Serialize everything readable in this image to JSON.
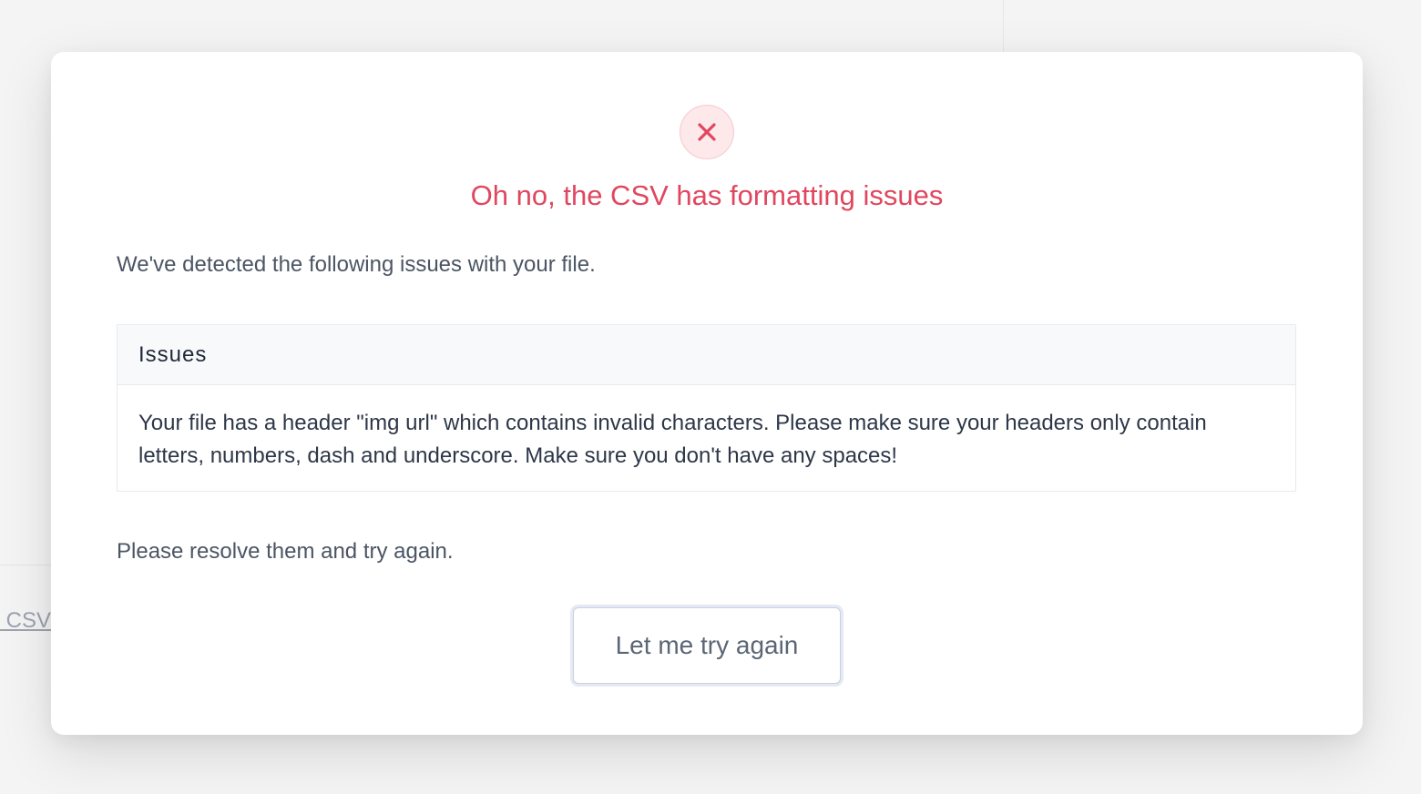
{
  "background": {
    "link_fragment": "Review CSV"
  },
  "modal": {
    "icon": "close-x-icon",
    "title": "Oh no, the CSV has formatting issues",
    "intro": "We've detected the following issues with your file.",
    "issues": {
      "header": "Issues",
      "items": [
        "Your file has a header \"img url\" which contains invalid characters. Please make sure your headers only contain letters, numbers, dash and underscore. Make sure you don't have any spaces!"
      ]
    },
    "outro": "Please resolve them and try again.",
    "retry_label": "Let me try again"
  },
  "colors": {
    "error": "#e0475f",
    "error_bg": "#fde8ea",
    "text": "#4b5563"
  }
}
